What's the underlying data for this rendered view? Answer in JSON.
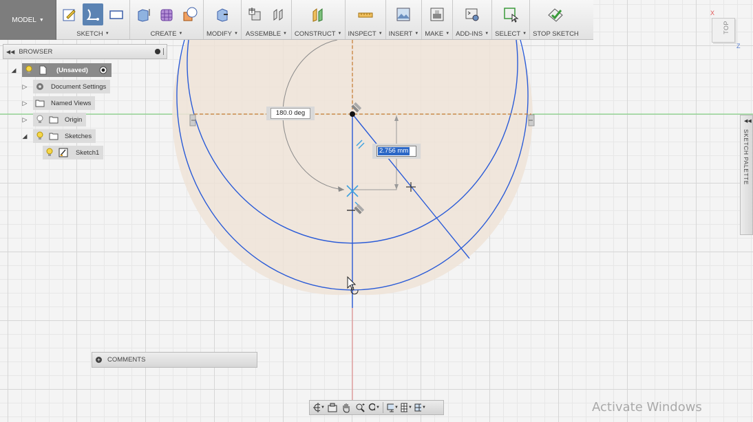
{
  "toolbar": {
    "workspace": "MODEL",
    "groups": [
      {
        "label": "SKETCH"
      },
      {
        "label": "CREATE"
      },
      {
        "label": "MODIFY"
      },
      {
        "label": "ASSEMBLE"
      },
      {
        "label": "CONSTRUCT"
      },
      {
        "label": "INSPECT"
      },
      {
        "label": "INSERT"
      },
      {
        "label": "MAKE"
      },
      {
        "label": "ADD-INS"
      },
      {
        "label": "SELECT"
      },
      {
        "label": "STOP SKETCH"
      }
    ]
  },
  "browser": {
    "title": "BROWSER",
    "items": [
      {
        "label": "(Unsaved)"
      },
      {
        "label": "Document Settings"
      },
      {
        "label": "Named Views"
      },
      {
        "label": "Origin"
      },
      {
        "label": "Sketches"
      },
      {
        "label": "Sketch1"
      }
    ]
  },
  "comments": {
    "label": "COMMENTS"
  },
  "sketch_palette": {
    "label": "SKETCH PALETTE"
  },
  "viewcube": {
    "face": "TOP",
    "axis_x": "X",
    "axis_z": "Z"
  },
  "dimensions": {
    "angle": "180.0 deg",
    "length": "2.756 mm"
  },
  "watermark": "Activate Windows",
  "colors": {
    "sketch_line": "#2a5bd7",
    "sketch_fill": "#efe3d7",
    "axis_green": "#5cc55c",
    "axis_red": "#e06868",
    "constraint_orange": "#d08a3a",
    "toolbar_active": "#5b83b3",
    "workspace_bg": "#7d7d7d"
  }
}
